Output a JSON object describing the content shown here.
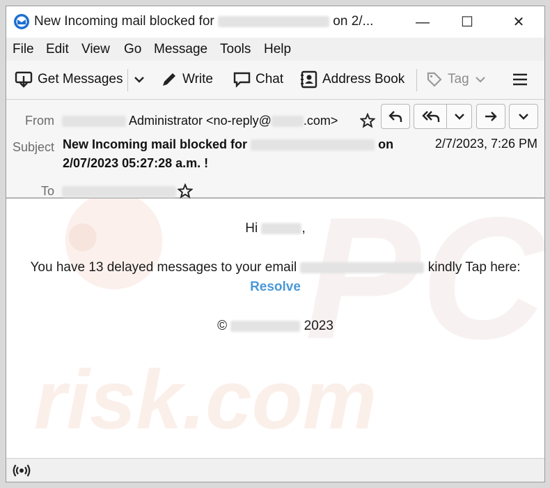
{
  "window": {
    "title_prefix": "New Incoming mail blocked for",
    "title_suffix": "on 2/...",
    "minimize": "—",
    "maximize": "☐",
    "close": "✕"
  },
  "menu": [
    "File",
    "Edit",
    "View",
    "Go",
    "Message",
    "Tools",
    "Help"
  ],
  "toolbar": {
    "get_messages": "Get Messages",
    "write": "Write",
    "chat": "Chat",
    "address_book": "Address Book",
    "tag": "Tag"
  },
  "header": {
    "from_label": "From",
    "from_name": "Administrator <no-reply@",
    "from_domain": ".com>",
    "subject_label": "Subject",
    "subject_prefix": "New Incoming mail blocked for",
    "subject_suffix": "on",
    "subject_line2": "2/07/2023 05:27:28 a.m. !",
    "date": "2/7/2023, 7:26 PM",
    "to_label": "To"
  },
  "body": {
    "greeting_prefix": "Hi",
    "greeting_suffix": ",",
    "message_prefix": "You have 13 delayed messages to your email",
    "message_suffix": "kindly Tap here:",
    "link_text": "Resolve",
    "copyright_symbol": "©",
    "copyright_year": "2023"
  },
  "watermark": {
    "top": "PC",
    "bottom": "risk.com"
  },
  "colors": {
    "link": "#4a98d8",
    "watermark": "#f6e7e2"
  }
}
